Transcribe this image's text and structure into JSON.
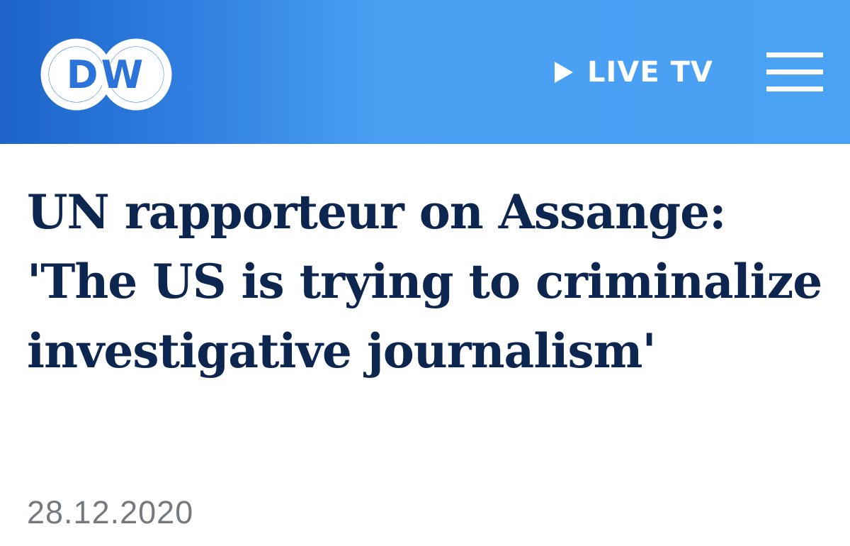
{
  "header": {
    "logo_text": "DW",
    "live_tv_label": "LIVE TV",
    "background_color": "#4aa2f5",
    "icons": [
      "dw-logo",
      "play-icon",
      "hamburger-menu-icon"
    ]
  },
  "article": {
    "headline": "UN rapporteur on Assange: 'The US is trying to criminalize investigative journalism'",
    "date": "28.12.2020",
    "headline_color": "#0d2650",
    "date_color": "#76797e"
  }
}
